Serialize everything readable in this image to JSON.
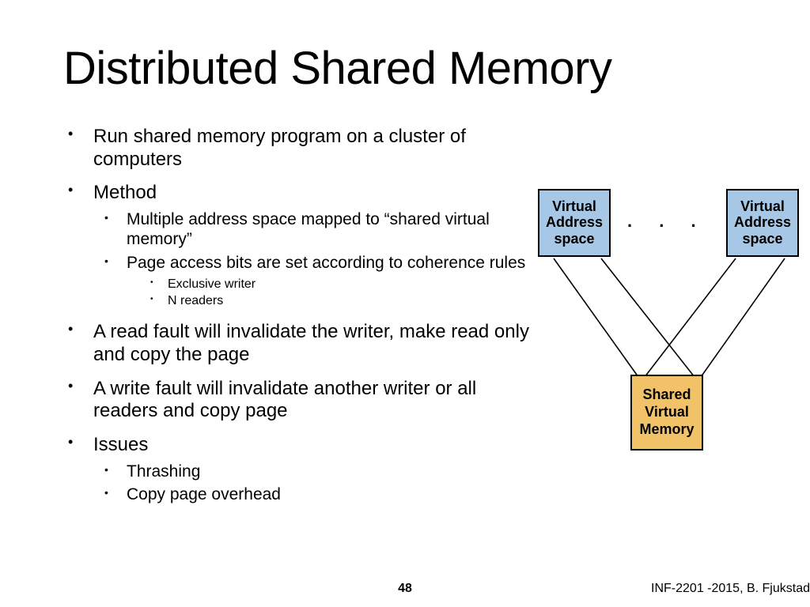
{
  "title": "Distributed Shared Memory",
  "bullets": {
    "b1": "Run shared memory program on a cluster of computers",
    "b2": "Method",
    "b2a": "Multiple address space mapped to “shared virtual memory”",
    "b2b": "Page access bits are set according to coherence rules",
    "b2b1": "Exclusive writer",
    "b2b2": "N readers",
    "b3": "A read fault will invalidate the writer, make read only and copy the page",
    "b4": "A write fault will invalidate another writer or all readers and copy page",
    "b5": "Issues",
    "b5a": "Thrashing",
    "b5b": "Copy page overhead"
  },
  "diagram": {
    "vas_left": "Virtual Address space",
    "vas_right": "Virtual Address space",
    "dots": ". . .",
    "svm": "Shared Virtual Memory"
  },
  "page_number": "48",
  "footer": "INF-2201 -2015, B. Fjukstad"
}
